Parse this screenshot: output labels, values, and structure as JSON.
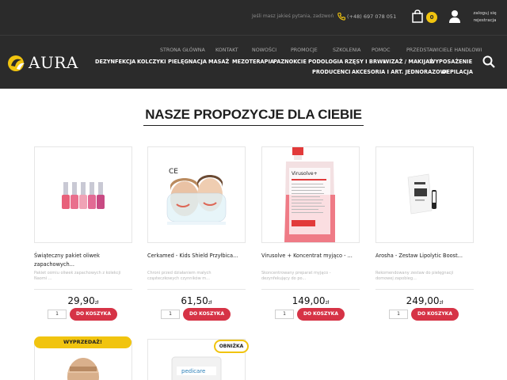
{
  "topbar": {
    "question": "Jeśli masz jakieś pytania, zadzwoń",
    "phone": "(+48) 697 078 051",
    "cart_count": "0",
    "login_line1": "zaloguj się",
    "login_line2": "rejestracja"
  },
  "logo": {
    "text": "AURA"
  },
  "nav": {
    "row1": [
      "STRONA GŁÓWNA",
      "KONTAKT",
      "NOWOŚCI",
      "PROMOCJE",
      "SZKOLENIA",
      "POMOC",
      "PRZEDSTAWICIELE HANDLOWI"
    ],
    "row2": [
      "DEZYNFEKCJA",
      "KOLCZYKI",
      "PIELĘGNACJA",
      "MASAŻ",
      "MEZOTERAPIA",
      "PAZNOKCIE",
      "PODOLOGIA",
      "RZĘSY I BRWI",
      "WIZAŻ / MAKIJAŻ",
      "WYPOSAŻENIE"
    ],
    "row3": [
      "PRODUCENCI",
      "AKCESORIA I ART. JEDNORAZOWE",
      "DEPILACJA"
    ]
  },
  "section": {
    "title": "NASZE PROPOZYCJE DLA CIEBIE"
  },
  "products": [
    {
      "name": "Świąteczny pakiet oliwek zapachowych...",
      "desc": "Pakiet ośmiu oliwek zapachowych z kolekcji Naomi ...",
      "price": "29,90",
      "currency": "zł",
      "qty": "1",
      "button": "DO KOSZYKA"
    },
    {
      "name": "Cerkamed - Kids Shield Przyłbica...",
      "desc": "Chroni przed działaniem małych cząsteczkowych czynników m...",
      "price": "61,50",
      "currency": "zł",
      "qty": "1",
      "button": "DO KOSZYKA"
    },
    {
      "name": "Virusolve + Koncentrat myjąco - ...",
      "desc": "Skoncentrowany preparat myjąco - dezynfekujący do po...",
      "price": "149,00",
      "currency": "zł",
      "qty": "1",
      "button": "DO KOSZYKA"
    },
    {
      "name": "Arosha - Zestaw Lipolytic Boost...",
      "desc": "Rekomendowany zestaw do pielęgnacji domowej zapobieg...",
      "price": "249,00",
      "currency": "zł",
      "qty": "1",
      "button": "DO KOSZYKA"
    }
  ],
  "badges": {
    "sale": "WYPRZEDAŻ!",
    "offer": "OBNIŻKA"
  },
  "images": {
    "pedicare_label": "pedicare",
    "virusolve_label": "Virusolve+",
    "ce_mark": "CE"
  },
  "colors": {
    "header_bg": "#2b2b2b",
    "accent_yellow": "#f1c40f",
    "button_red": "#d63346"
  }
}
